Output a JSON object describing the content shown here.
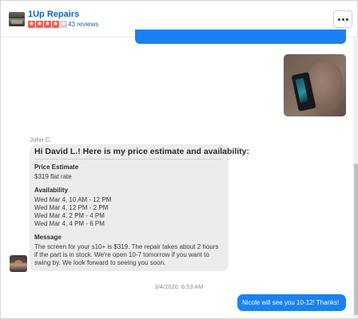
{
  "header": {
    "business_name": "1Up Repairs",
    "rating": 4,
    "rating_max": 5,
    "reviews_text": "43 reviews",
    "more_icon": "ellipsis-icon"
  },
  "colors": {
    "accent_blue": "#1a82f0",
    "link_blue": "#0b64c0",
    "star_red": "#f15c4f"
  },
  "messages": {
    "top_partial": "",
    "sender": "John C.",
    "quote": {
      "heading": "Hi David L.! Here is my price estimate and availability:",
      "price_label": "Price Estimate",
      "price_value": "$319 flat rate",
      "availability_label": "Availability",
      "availability": [
        "Wed Mar 4, 10 AM - 12 PM",
        "Wed Mar 4, 12 PM - 2 PM",
        "Wed Mar 4, 2 PM - 4 PM",
        "Wed Mar 4, 4 PM - 6 PM"
      ],
      "message_label": "Message",
      "message_lines": [
        "The screen for your s10+ is $319. The repair takes about 2 hours",
        "if the part is in stock. We're open 10-7 tomorrow if you want to",
        "swing by. We look forward to seeing you soon."
      ]
    },
    "timestamp": "3/4/2020, 6:53 AM",
    "reply": "Nicole will see you 10-12!  Thanks!"
  }
}
